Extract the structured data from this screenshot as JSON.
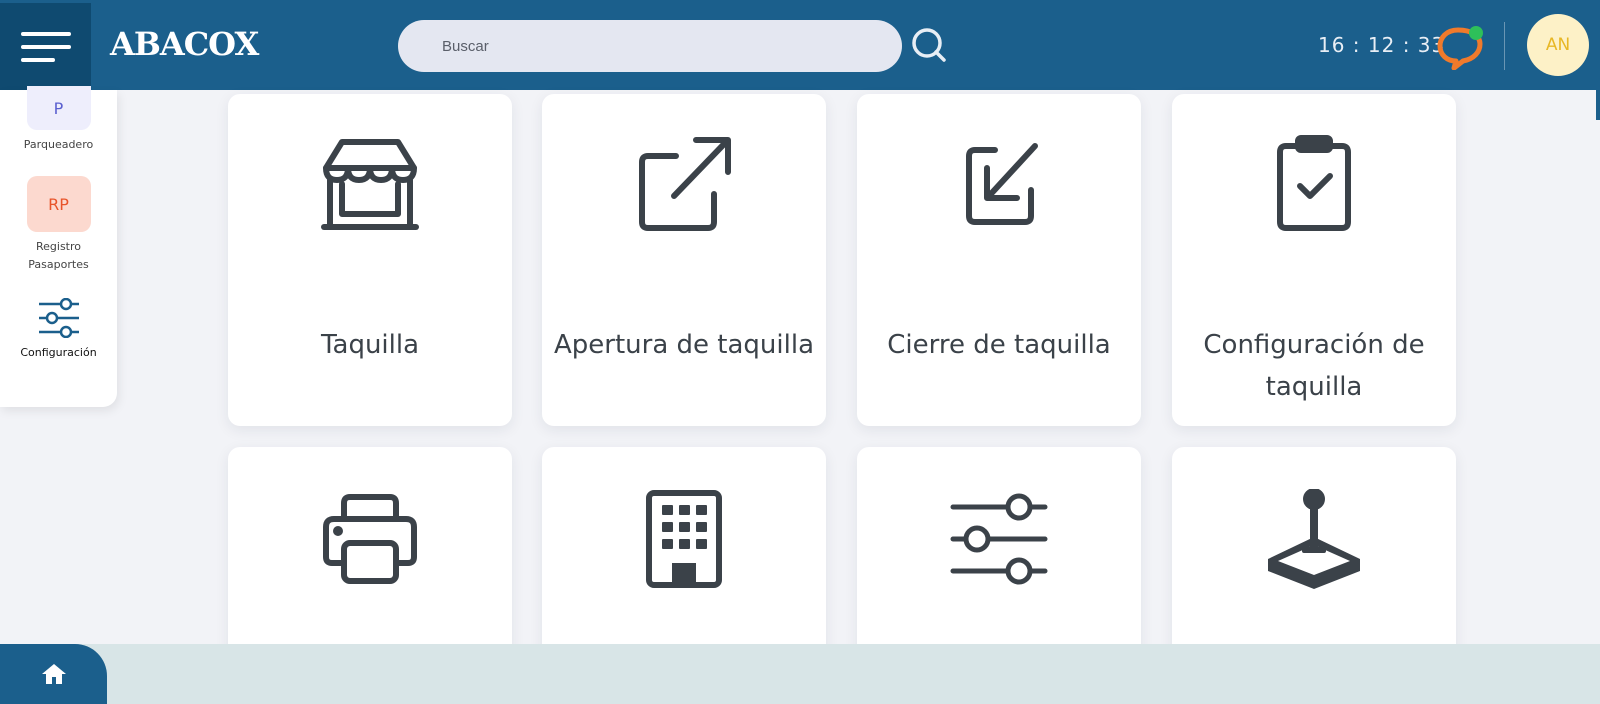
{
  "header": {
    "logo_text": "ABACOX",
    "search": {
      "placeholder": "Buscar",
      "value": ""
    },
    "clock": "16 : 12 : 33",
    "avatar_initials": "AN"
  },
  "sidebar": {
    "items": [
      {
        "badge": "P",
        "label": "Parqueadero"
      },
      {
        "badge": "RP",
        "label": "Registro Pasaportes"
      },
      {
        "badge": "",
        "label": "Configuración"
      }
    ]
  },
  "cards": [
    {
      "label": "Taquilla",
      "icon": "store-icon"
    },
    {
      "label": "Apertura de taquilla",
      "icon": "external-link-icon"
    },
    {
      "label": "Cierre de taquilla",
      "icon": "arrow-in-box-icon"
    },
    {
      "label": "Configuración de taquilla",
      "icon": "clipboard-check-icon"
    },
    {
      "label": "",
      "icon": "printer-icon"
    },
    {
      "label": "",
      "icon": "building-icon"
    },
    {
      "label": "",
      "icon": "sliders-icon"
    },
    {
      "label": "",
      "icon": "joystick-icon"
    }
  ],
  "colors": {
    "header": "#1b5f8c",
    "menu_button": "#0f4a70",
    "icon": "#3b4249",
    "footer": "#d8e5e7",
    "badge_p_bg": "#eeeefc",
    "badge_rp_bg": "#fcd9cf"
  }
}
